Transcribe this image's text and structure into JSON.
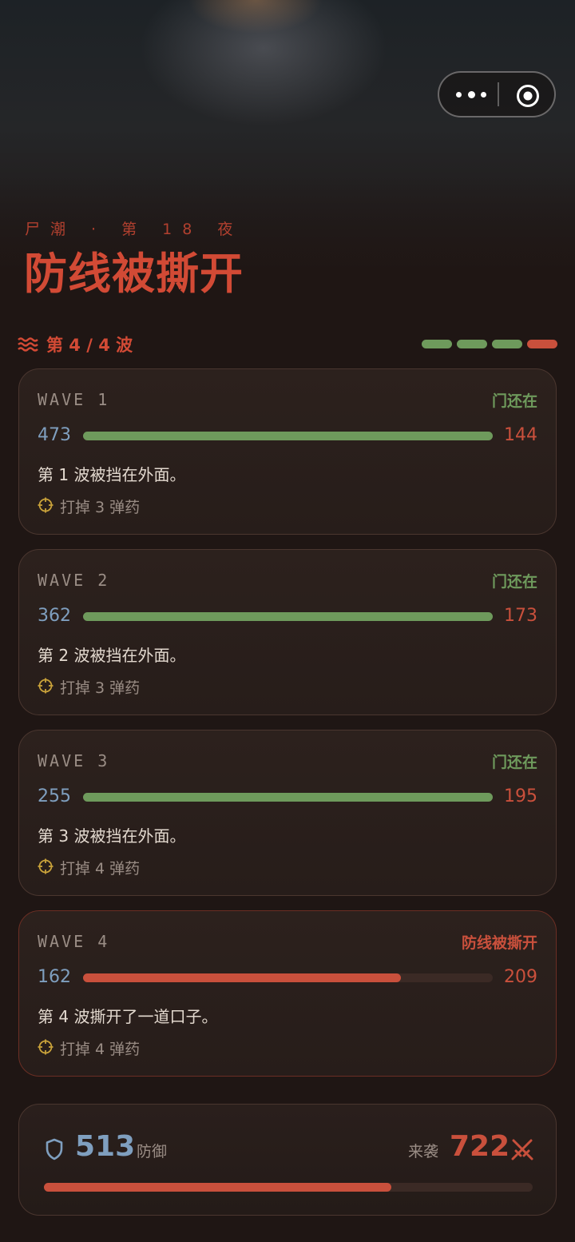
{
  "header": {
    "subtitle": "尸潮 · 第 18 夜",
    "title": "防线被撕开"
  },
  "wave_header": {
    "label": "第 4 / 4 波",
    "progress_colors": [
      "#6e9a5c",
      "#6e9a5c",
      "#6e9a5c",
      "#c9503c"
    ]
  },
  "waves": [
    {
      "label": "WAVE 1",
      "status": "门还在",
      "status_color": "#6e9a5c",
      "defense": "473",
      "attack": "144",
      "bar_fraction": 1.0,
      "bar_color": "#6e9a5c",
      "description": "第 1 波被挡在外面。",
      "ammo": "打掉 3 弹药"
    },
    {
      "label": "WAVE 2",
      "status": "门还在",
      "status_color": "#6e9a5c",
      "defense": "362",
      "attack": "173",
      "bar_fraction": 1.0,
      "bar_color": "#6e9a5c",
      "description": "第 2 波被挡在外面。",
      "ammo": "打掉 3 弹药"
    },
    {
      "label": "WAVE 3",
      "status": "门还在",
      "status_color": "#6e9a5c",
      "defense": "255",
      "attack": "195",
      "bar_fraction": 1.0,
      "bar_color": "#6e9a5c",
      "description": "第 3 波被挡在外面。",
      "ammo": "打掉 4 弹药"
    },
    {
      "label": "WAVE 4",
      "status": "防线被撕开",
      "status_color": "#c9503c",
      "defense": "162",
      "attack": "209",
      "bar_fraction": 0.775,
      "bar_color": "#c9503c",
      "description": "第 4 波撕开了一道口子。",
      "ammo": "打掉 4 弹药"
    }
  ],
  "summary": {
    "defense_value": "513",
    "defense_label": "防御",
    "attack_label": "来袭",
    "attack_value": "722",
    "bar_fraction": 0.71,
    "bar_color": "#c9503c"
  },
  "colors": {
    "accent": "#d24a35",
    "green": "#6e9a5c",
    "blue": "#7f9fbf",
    "background": "#1f1614"
  },
  "icons": {
    "menu": "more-dots-icon",
    "close": "target-close-icon",
    "waves": "waves-icon",
    "ammo": "crosshair-icon",
    "defense": "shield-icon",
    "attack": "crossed-swords-icon"
  }
}
